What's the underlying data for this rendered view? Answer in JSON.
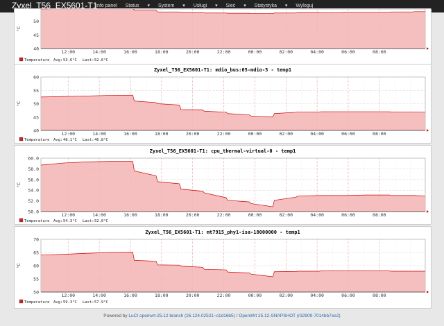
{
  "navbar": {
    "brand": "Zyxel_T56_EX5601-T1",
    "items": [
      "Info panel",
      "Status",
      "System",
      "Usługi",
      "Sieć",
      "Statystyka",
      "Wyloguj"
    ]
  },
  "charts": [
    {
      "title": "",
      "ylabel": "°C",
      "legend": "Temperature",
      "avg_label": "Avg:",
      "avg": "53.6°C",
      "last_label": "Last:",
      "last": "52.6°C",
      "yticks": [
        "40",
        "45",
        "50",
        "55"
      ],
      "ylim": [
        40,
        57
      ],
      "xticks": [
        "12:00",
        "14:00",
        "16:00",
        "18:00",
        "20:00",
        "22:00",
        "00:00",
        "02:00",
        "04:00",
        "06:00",
        "08:00"
      ]
    },
    {
      "title": "Zyxel_T56_EX5601-T1: mdio_bus:05-mdio-5 - temp1",
      "ylabel": "°C",
      "legend": "Temperature",
      "avg_label": "Avg:",
      "avg": "48.1°C",
      "last_label": "Last:",
      "last": "46.8°C",
      "yticks": [
        "40",
        "45",
        "50",
        "55",
        "60"
      ],
      "ylim": [
        40,
        60
      ],
      "xticks": [
        "12:00",
        "14:00",
        "16:00",
        "18:00",
        "20:00",
        "22:00",
        "00:00",
        "02:00",
        "04:00",
        "06:00",
        "08:00"
      ]
    },
    {
      "title": "Zyxel_T56_EX5601-T1: cpu_thermal-virtual-0 - temp1",
      "ylabel": "°C",
      "legend": "Temperature",
      "avg_label": "Avg:",
      "avg": "54.3°C",
      "last_label": "Last:",
      "last": "52.0°C",
      "yticks": [
        "50.0",
        "52.0",
        "54.0",
        "56.0",
        "58.0",
        "60.0"
      ],
      "ylim": [
        50,
        60
      ],
      "xticks": [
        "12:00",
        "14:00",
        "16:00",
        "18:00",
        "20:00",
        "22:00",
        "00:00",
        "02:00",
        "04:00",
        "06:00",
        "08:00"
      ]
    },
    {
      "title": "Zyxel_T56_EX5601-T1: mt7915_phy1-isa-18000000 - temp1",
      "ylabel": "°C",
      "legend": "Temperature",
      "avg_label": "Avg:",
      "avg": "59.3°C",
      "last_label": "Last:",
      "last": "57.9°C",
      "yticks": [
        "50",
        "55",
        "60",
        "65",
        "70"
      ],
      "ylim": [
        50,
        70
      ],
      "xticks": [
        "12:00",
        "14:00",
        "16:00",
        "18:00",
        "20:00",
        "22:00",
        "00:00",
        "02:00",
        "04:00",
        "06:00",
        "08:00"
      ]
    }
  ],
  "footer": {
    "prefix": "Powered by",
    "luci": "LuCI openwrt-25.12 branch (26.124.02521~c1d16b5)",
    "sep": "/",
    "openwrt": "OpenWrt 25.12-SNAPSHOT (r32909-7014bb7ee2)"
  },
  "colors": {
    "fill": "#f4b4b4",
    "line": "#cc0000",
    "grid": "#c8c8c8",
    "navbar": "#222222"
  },
  "chart_data": [
    {
      "type": "area",
      "title": "",
      "ylabel": "°C",
      "ylim": [
        40,
        57
      ],
      "series": [
        {
          "name": "Temperature",
          "x": [
            0,
            1.5,
            3.0,
            4.5,
            5.9,
            6.0,
            7.4,
            7.5,
            8.9,
            9.0,
            10.4,
            10.5,
            11.9,
            12.0,
            13.4,
            13.5,
            14.9,
            15.0,
            16.4,
            16.5,
            17.9,
            18.0,
            19.4,
            19.5,
            20.9,
            21.0,
            22.4,
            22.5,
            23.9,
            24.0,
            24.7
          ],
          "y": [
            54.5,
            54.6,
            54.7,
            54.8,
            54.8,
            54.0,
            54.0,
            53.4,
            53.4,
            53.2,
            53.2,
            53.0,
            53.0,
            52.9,
            52.9,
            52.8,
            52.8,
            53.0,
            53.0,
            53.2,
            53.2,
            53.1,
            53.1,
            53.3,
            53.3,
            53.3,
            53.3,
            53.4,
            53.4,
            53.5,
            53.5
          ]
        }
      ],
      "legend": "bottom"
    },
    {
      "type": "area",
      "title": "Zyxel_T56_EX5601-T1: mdio_bus:05-mdio-5 - temp1",
      "ylabel": "°C",
      "ylim": [
        40,
        60
      ],
      "series": [
        {
          "name": "Temperature",
          "x": [
            0,
            1.5,
            3.0,
            4.5,
            5.9,
            6.0,
            7.4,
            7.5,
            8.9,
            9.0,
            10.4,
            10.5,
            11.9,
            12.0,
            13.4,
            13.5,
            14.9,
            15.0,
            16.4,
            16.5,
            17.9,
            18.0,
            19.4,
            19.5,
            20.9,
            21.0,
            22.4,
            22.5,
            23.9,
            24.0,
            24.7
          ],
          "y": [
            52.5,
            52.7,
            52.9,
            53.1,
            53.2,
            51.0,
            50.4,
            50.0,
            49.5,
            47.8,
            47.7,
            47.2,
            46.8,
            46.3,
            45.8,
            45.4,
            45.0,
            46.3,
            46.8,
            46.9,
            46.9,
            47.0,
            47.0,
            47.0,
            47.0,
            47.0,
            47.0,
            46.9,
            46.9,
            46.9,
            46.8
          ]
        }
      ],
      "legend": "bottom"
    },
    {
      "type": "area",
      "title": "Zyxel_T56_EX5601-T1: cpu_thermal-virtual-0 - temp1",
      "ylabel": "°C",
      "ylim": [
        50,
        60
      ],
      "series": [
        {
          "name": "Temperature",
          "x": [
            0,
            1.5,
            3.0,
            4.5,
            5.9,
            6.0,
            7.4,
            7.5,
            8.9,
            9.0,
            10.4,
            10.5,
            11.9,
            12.0,
            13.4,
            13.5,
            14.9,
            15.0,
            16.4,
            16.5,
            17.9,
            18.0,
            19.4,
            19.5,
            20.9,
            21.0,
            22.4,
            22.5,
            23.9,
            24.0,
            24.7
          ],
          "y": [
            58.7,
            59.1,
            59.3,
            59.4,
            59.4,
            57.6,
            56.7,
            55.6,
            55.2,
            54.2,
            53.8,
            53.5,
            52.6,
            52.1,
            51.8,
            51.5,
            50.9,
            52.1,
            52.7,
            52.9,
            53.0,
            53.0,
            53.0,
            53.0,
            53.1,
            53.1,
            53.1,
            53.0,
            53.0,
            53.0,
            52.9
          ]
        }
      ],
      "legend": "bottom"
    },
    {
      "type": "area",
      "title": "Zyxel_T56_EX5601-T1: mt7915_phy1-isa-18000000 - temp1",
      "ylabel": "°C",
      "ylim": [
        50,
        70
      ],
      "series": [
        {
          "name": "Temperature",
          "x": [
            0,
            1.5,
            3.0,
            4.5,
            5.9,
            6.0,
            7.4,
            7.5,
            8.9,
            9.0,
            10.4,
            10.5,
            11.9,
            12.0,
            13.4,
            13.5,
            14.9,
            15.0,
            16.4,
            16.5,
            17.9,
            18.0,
            19.4,
            19.5,
            20.9,
            21.0,
            22.4,
            22.5,
            23.9,
            24.0,
            24.7
          ],
          "y": [
            64.0,
            64.3,
            64.7,
            65.0,
            65.1,
            62.0,
            61.7,
            60.3,
            60.2,
            59.8,
            59.4,
            58.6,
            58.4,
            57.6,
            57.2,
            56.8,
            55.8,
            57.7,
            57.8,
            57.9,
            57.9,
            58.0,
            58.0,
            58.0,
            58.0,
            58.0,
            58.0,
            57.9,
            57.9,
            57.9,
            57.9
          ]
        }
      ],
      "legend": "bottom"
    }
  ]
}
